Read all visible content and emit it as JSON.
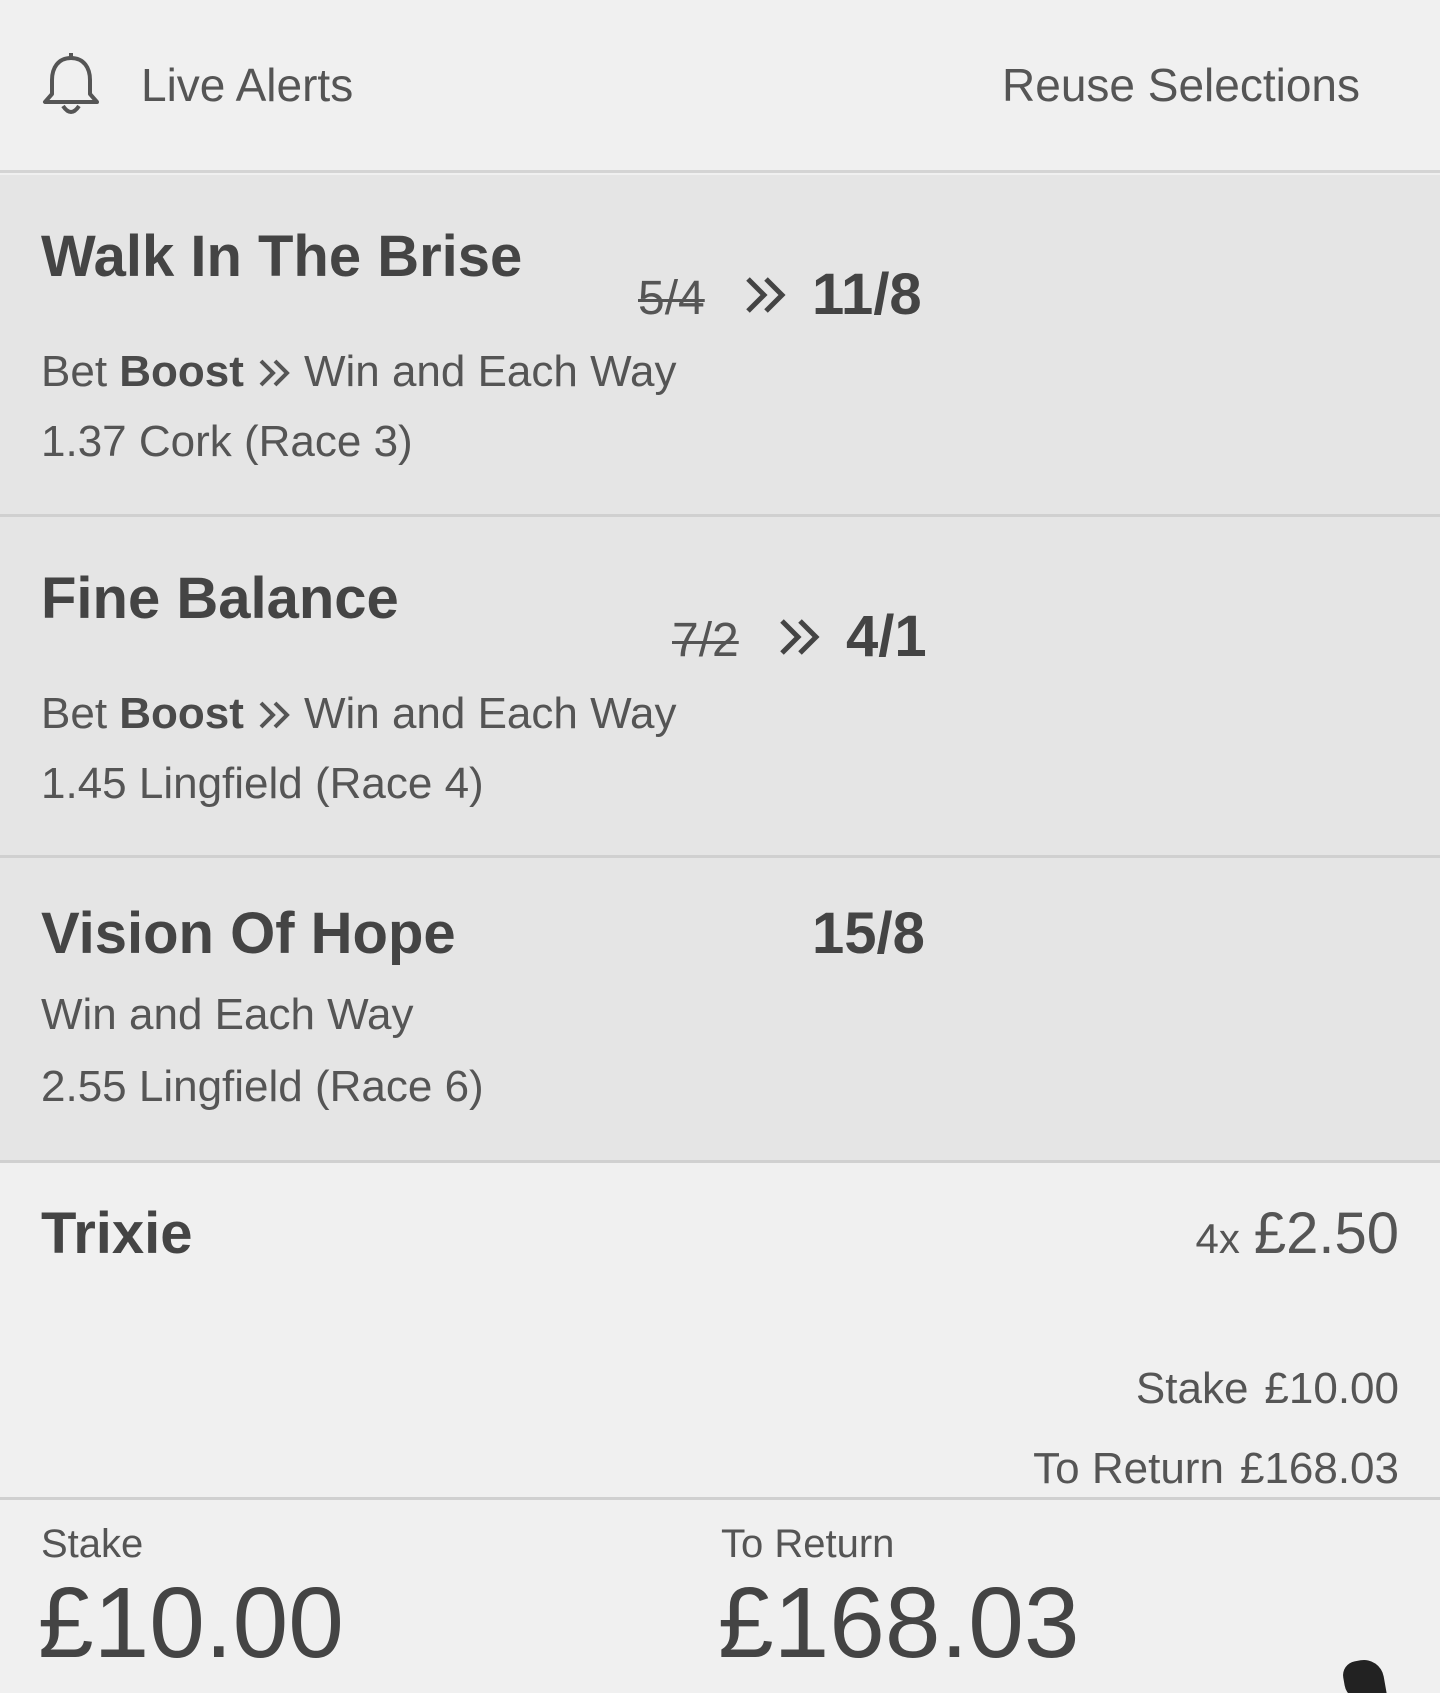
{
  "header": {
    "bell_icon": "bell-icon",
    "live_alerts": "Live Alerts",
    "reuse_selections": "Reuse Selections"
  },
  "selections": [
    {
      "runner": "Walk In The Brise",
      "odds_old": "5/4",
      "odds_new": "11/8",
      "boost_prefix": "Bet",
      "boost_word": "Boost",
      "market": "Win and Each Way",
      "event": "1.37 Cork (Race 3)"
    },
    {
      "runner": "Fine Balance",
      "odds_old": "7/2",
      "odds_new": "4/1",
      "boost_prefix": "Bet",
      "boost_word": "Boost",
      "market": "Win and Each Way",
      "event": "1.45 Lingfield (Race 4)"
    },
    {
      "runner": "Vision Of Hope",
      "odds_new": "15/8",
      "market": "Win and Each Way",
      "event": "2.55 Lingfield (Race 6)"
    }
  ],
  "bet": {
    "type": "Trixie",
    "multiplier": "4x",
    "unit_stake": "£2.50",
    "stake_label": "Stake",
    "stake_value": "£10.00",
    "return_label": "To Return",
    "return_value": "£168.03"
  },
  "footer": {
    "stake_label": "Stake",
    "stake_value": "£10.00",
    "return_label": "To Return",
    "return_value": "£168.03"
  }
}
